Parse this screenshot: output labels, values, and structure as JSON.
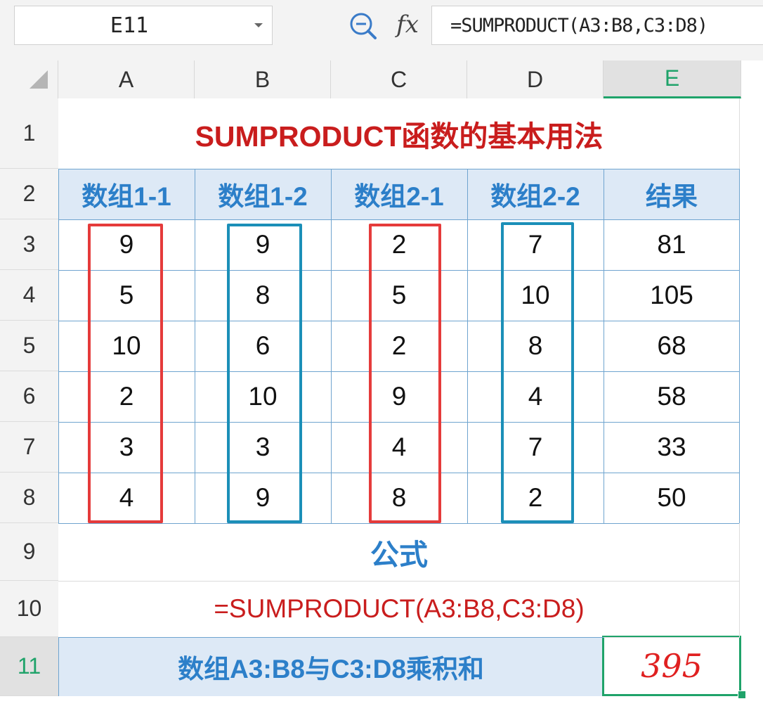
{
  "formula_bar": {
    "name_box": "E11",
    "zoom_icon": "zoom-out-icon",
    "fx_label": "fx",
    "formula": "=SUMPRODUCT(A3:B8,C3:D8)"
  },
  "columns": [
    "A",
    "B",
    "C",
    "D",
    "E"
  ],
  "rows": [
    "1",
    "2",
    "3",
    "4",
    "5",
    "6",
    "7",
    "8",
    "9",
    "10",
    "11"
  ],
  "selected_cell": "E11",
  "colors": {
    "title": "#c91d1d",
    "header_text": "#2c7fc9",
    "header_fill": "#dde9f6",
    "selection": "#1fa36a",
    "box_red": "#e53b3b",
    "box_blue": "#1b8fb8"
  },
  "sheet": {
    "title": "SUMPRODUCT函数的基本用法",
    "headers": [
      "数组1-1",
      "数组1-2",
      "数组2-1",
      "数组2-2",
      "结果"
    ],
    "data": [
      [
        "9",
        "9",
        "2",
        "7",
        "81"
      ],
      [
        "5",
        "8",
        "5",
        "10",
        "105"
      ],
      [
        "10",
        "6",
        "2",
        "8",
        "68"
      ],
      [
        "2",
        "10",
        "9",
        "4",
        "58"
      ],
      [
        "3",
        "3",
        "4",
        "7",
        "33"
      ],
      [
        "4",
        "9",
        "8",
        "2",
        "50"
      ]
    ],
    "formula_label": "公式",
    "formula_text": "=SUMPRODUCT(A3:B8,C3:D8)",
    "summary_label": "数组A3:B8与C3:D8乘积和",
    "summary_value": "395"
  }
}
